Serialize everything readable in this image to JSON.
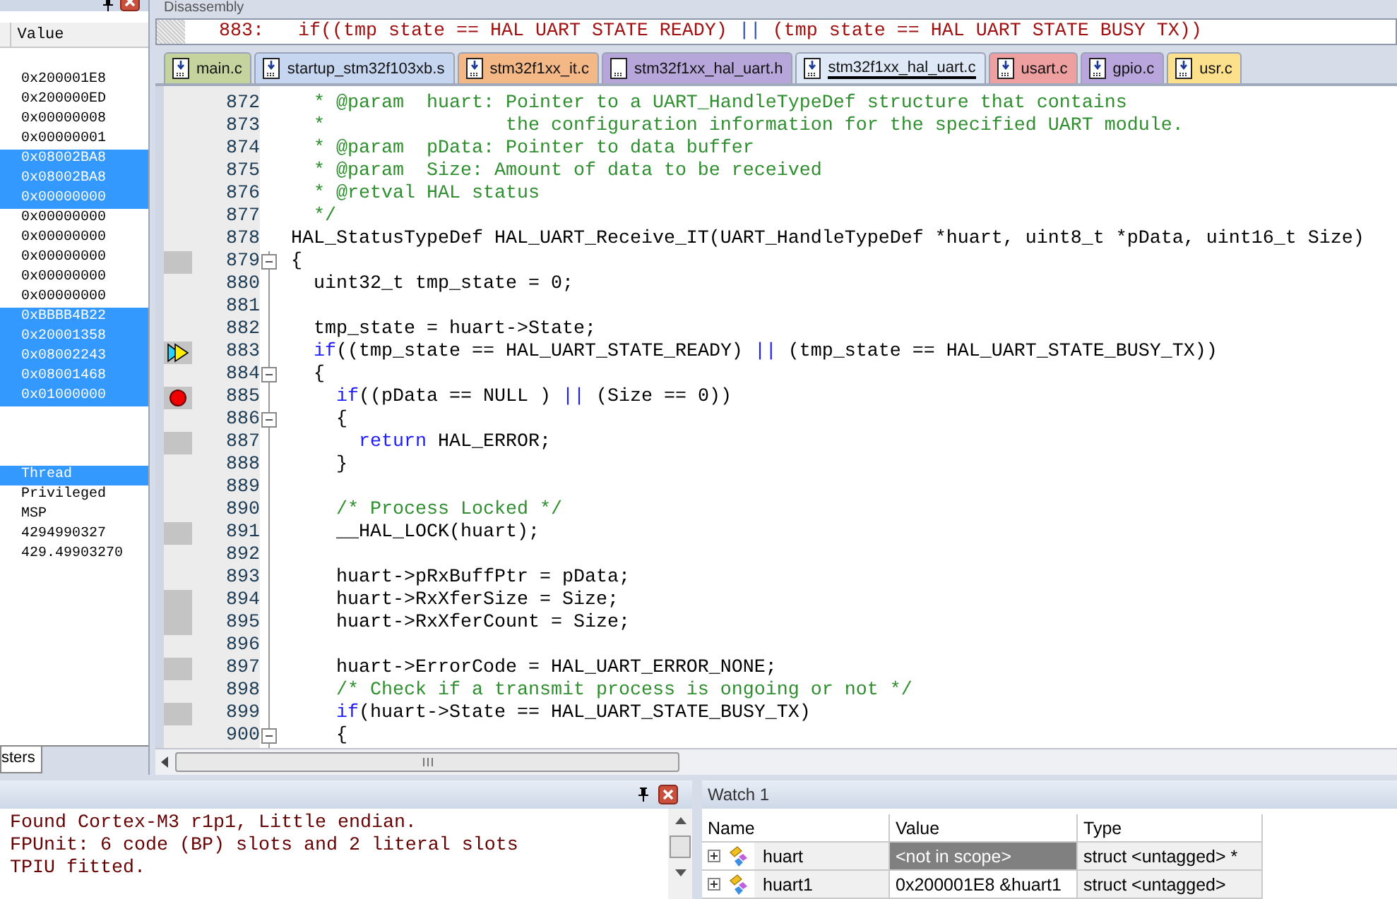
{
  "registers": {
    "column": "Value",
    "rows": [
      {
        "kind": "group"
      },
      {
        "kind": "value",
        "value": "0x200001E8",
        "selected": false
      },
      {
        "kind": "value",
        "value": "0x200000ED",
        "selected": false
      },
      {
        "kind": "value",
        "value": "0x00000008",
        "selected": false
      },
      {
        "kind": "value",
        "value": "0x00000001",
        "selected": false
      },
      {
        "kind": "value",
        "value": "0x08002BA8",
        "selected": true
      },
      {
        "kind": "value",
        "value": "0x08002BA8",
        "selected": true
      },
      {
        "kind": "value",
        "value": "0x00000000",
        "selected": true
      },
      {
        "kind": "value",
        "value": "0x00000000",
        "selected": false
      },
      {
        "kind": "value",
        "value": "0x00000000",
        "selected": false
      },
      {
        "kind": "value",
        "value": "0x00000000",
        "selected": false
      },
      {
        "kind": "value",
        "value": "0x00000000",
        "selected": false
      },
      {
        "kind": "value",
        "value": "0x00000000",
        "selected": false
      },
      {
        "kind": "value",
        "value": "0xBBBB4B22",
        "selected": true
      },
      {
        "kind": "value",
        "value": "0x20001358",
        "selected": true
      },
      {
        "kind": "value",
        "value": "0x08002243",
        "selected": true
      },
      {
        "kind": "value",
        "value": "0x08001468",
        "selected": true
      },
      {
        "kind": "value",
        "value": "0x01000000",
        "selected": true
      },
      {
        "kind": "group"
      },
      {
        "kind": "group"
      },
      {
        "kind": "group"
      },
      {
        "kind": "value",
        "value": "Thread",
        "selected": true
      },
      {
        "kind": "value",
        "value": "Privileged",
        "selected": false
      },
      {
        "kind": "value",
        "value": "MSP",
        "selected": false
      },
      {
        "kind": "value",
        "value": "4294990327",
        "selected": false
      },
      {
        "kind": "value",
        "value": "429.49903270",
        "selected": false
      }
    ],
    "tab": "sters"
  },
  "disassembly": {
    "title": "Disassembly",
    "line": [
      {
        "kind": "plain",
        "text": "883:   if((tmp state == HAL UART STATE READY) "
      },
      {
        "kind": "keyword",
        "text": "||"
      },
      {
        "kind": "plain",
        "text": " (tmp state == HAL UART STATE BUSY TX))"
      }
    ]
  },
  "tabs": [
    {
      "label": "main.c",
      "kind": "arrow-doc",
      "color": "#c5d49e",
      "selected": false
    },
    {
      "label": "startup_stm32f103xb.s",
      "kind": "arrow-doc",
      "color": "#c6d6f0",
      "selected": false
    },
    {
      "label": "stm32f1xx_it.c",
      "kind": "arrow-doc",
      "color": "#f4b887",
      "selected": false
    },
    {
      "label": "stm32f1xx_hal_uart.h",
      "kind": "doc",
      "color": "#b6a6da",
      "selected": false
    },
    {
      "label": "stm32f1xx_hal_uart.c",
      "kind": "arrow-doc",
      "color": "#dfe8f6",
      "selected": true
    },
    {
      "label": "usart.c",
      "kind": "arrow-doc",
      "color": "#ee9fa0",
      "selected": false
    },
    {
      "label": "gpio.c",
      "kind": "arrow-doc",
      "color": "#b8a6dc",
      "selected": false
    },
    {
      "label": "usr.c",
      "kind": "arrow-doc",
      "color": "#fde08c",
      "selected": false
    }
  ],
  "code": [
    {
      "number": "872",
      "kind": "plain",
      "tokens": [
        {
          "kind": "comment",
          "text": "  * @param  huart: Pointer to a UART_HandleTypeDef structure that contains"
        }
      ]
    },
    {
      "number": "873",
      "kind": "plain",
      "tokens": [
        {
          "kind": "comment",
          "text": "  *                the configuration information for the specified UART module."
        }
      ]
    },
    {
      "number": "874",
      "kind": "plain",
      "tokens": [
        {
          "kind": "comment",
          "text": "  * @param  pData: Pointer to data buffer"
        }
      ]
    },
    {
      "number": "875",
      "kind": "plain",
      "tokens": [
        {
          "kind": "comment",
          "text": "  * @param  Size: Amount of data to be received"
        }
      ]
    },
    {
      "number": "876",
      "kind": "plain",
      "tokens": [
        {
          "kind": "comment",
          "text": "  * @retval HAL status"
        }
      ]
    },
    {
      "number": "877",
      "kind": "plain",
      "tokens": [
        {
          "kind": "comment",
          "text": "  */"
        }
      ]
    },
    {
      "number": "878",
      "kind": "plain",
      "tokens": [
        {
          "kind": "plain",
          "text": "HAL_StatusTypeDef HAL_UART_Receive_IT(UART_HandleTypeDef *huart, uint8_t *pData, uint16_t Size)"
        }
      ]
    },
    {
      "number": "879",
      "kind": "exec",
      "fold": {
        "expanded": true
      },
      "tokens": [
        {
          "kind": "plain",
          "text": "{"
        }
      ]
    },
    {
      "number": "880",
      "kind": "plain",
      "tokens": [
        {
          "kind": "plain",
          "text": "  uint32_t tmp_state = 0;"
        }
      ]
    },
    {
      "number": "881",
      "kind": "plain"
    },
    {
      "number": "882",
      "kind": "plain",
      "tokens": [
        {
          "kind": "plain",
          "text": "  tmp_state = huart->State;"
        }
      ]
    },
    {
      "number": "883",
      "kind": "current",
      "tokens": [
        {
          "kind": "keyword",
          "text": "  if"
        },
        {
          "kind": "plain",
          "text": "((tmp_state == HAL_UART_STATE_READY) "
        },
        {
          "kind": "keyword",
          "text": "||"
        },
        {
          "kind": "plain",
          "text": " (tmp_state == HAL_UART_STATE_BUSY_TX))"
        }
      ]
    },
    {
      "number": "884",
      "kind": "plain",
      "fold": {
        "expanded": true
      },
      "tokens": [
        {
          "kind": "plain",
          "text": "  {"
        }
      ]
    },
    {
      "number": "885",
      "kind": "breakpoint",
      "tokens": [
        {
          "kind": "keyword",
          "text": "    if"
        },
        {
          "kind": "plain",
          "text": "((pData == NULL ) "
        },
        {
          "kind": "keyword",
          "text": "||"
        },
        {
          "kind": "plain",
          "text": " (Size == 0))"
        }
      ]
    },
    {
      "number": "886",
      "kind": "plain",
      "fold": {
        "expanded": true
      },
      "tokens": [
        {
          "kind": "plain",
          "text": "    {"
        }
      ]
    },
    {
      "number": "887",
      "kind": "exec",
      "tokens": [
        {
          "kind": "keyword",
          "text": "      return"
        },
        {
          "kind": "plain",
          "text": " HAL_ERROR;"
        }
      ]
    },
    {
      "number": "888",
      "kind": "plain",
      "tokens": [
        {
          "kind": "plain",
          "text": "    }"
        }
      ]
    },
    {
      "number": "889",
      "kind": "plain"
    },
    {
      "number": "890",
      "kind": "plain",
      "tokens": [
        {
          "kind": "comment",
          "text": "    /* Process Locked */"
        }
      ]
    },
    {
      "number": "891",
      "kind": "exec",
      "tokens": [
        {
          "kind": "plain",
          "text": "    __HAL_LOCK(huart);"
        }
      ]
    },
    {
      "number": "892",
      "kind": "plain"
    },
    {
      "number": "893",
      "kind": "plain",
      "tokens": [
        {
          "kind": "plain",
          "text": "    huart->pRxBuffPtr = pData;"
        }
      ]
    },
    {
      "number": "894",
      "kind": "exec",
      "tokens": [
        {
          "kind": "plain",
          "text": "    huart->RxXferSize = Size;"
        }
      ]
    },
    {
      "number": "895",
      "kind": "exec",
      "tokens": [
        {
          "kind": "plain",
          "text": "    huart->RxXferCount = Size;"
        }
      ]
    },
    {
      "number": "896",
      "kind": "plain"
    },
    {
      "number": "897",
      "kind": "exec",
      "tokens": [
        {
          "kind": "plain",
          "text": "    huart->ErrorCode = HAL_UART_ERROR_NONE;"
        }
      ]
    },
    {
      "number": "898",
      "kind": "plain",
      "tokens": [
        {
          "kind": "comment",
          "text": "    /* Check if a transmit process is ongoing or not */"
        }
      ]
    },
    {
      "number": "899",
      "kind": "exec",
      "tokens": [
        {
          "kind": "keyword",
          "text": "    if"
        },
        {
          "kind": "plain",
          "text": "(huart->State == HAL_UART_STATE_BUSY_TX)"
        }
      ]
    },
    {
      "number": "900",
      "kind": "plain",
      "fold": {
        "expanded": true
      },
      "tokens": [
        {
          "kind": "plain",
          "text": "    {"
        }
      ]
    }
  ],
  "output": {
    "lines": [
      "Found Cortex-M3 r1p1, Little endian.",
      "FPUnit: 6 code (BP) slots and 2 literal slots",
      "TPIU fitted."
    ]
  },
  "watch": {
    "title": "Watch 1",
    "columns": [
      "Name",
      "Value",
      "Type"
    ],
    "rows": [
      {
        "name": "huart",
        "value": "<not in scope>",
        "type": "struct <untagged> *",
        "disabled": true
      },
      {
        "name": "huart1",
        "value": "0x200001E8 &huart1",
        "type": "struct <untagged>",
        "disabled": false
      }
    ]
  }
}
